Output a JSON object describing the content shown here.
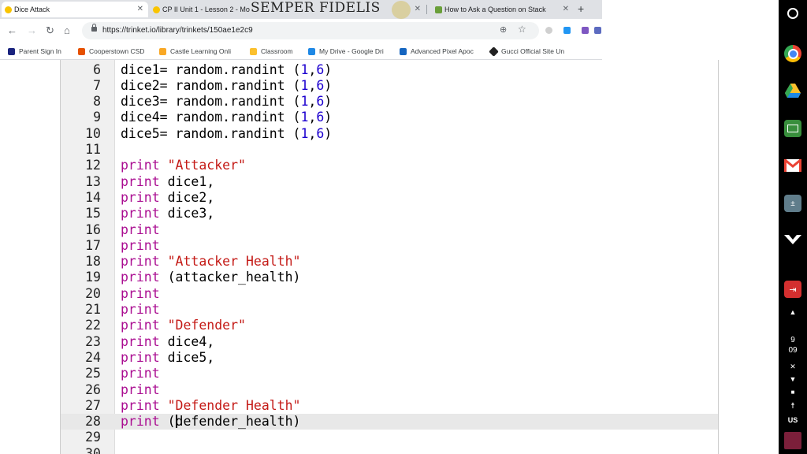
{
  "browser": {
    "tabs": [
      {
        "title": "Dice Attack",
        "active": true
      },
      {
        "title": "CP II Unit 1 - Lesson 2 - Mo",
        "active": false
      },
      {
        "title": "How to Ask a Question on Stack",
        "active": false
      }
    ],
    "new_tab_symbol": "+",
    "url": "https://trinket.io/library/trinkets/150ae1e2c9",
    "bookmarks": [
      {
        "label": "Parent Sign In",
        "icon": "parent-portal-icon",
        "color": "#1a237e"
      },
      {
        "label": "Cooperstown CSD",
        "icon": "cooperstown-icon",
        "color": "#e65100"
      },
      {
        "label": "Castle Learning Onli",
        "icon": "castle-learning-icon",
        "color": "#f9a825"
      },
      {
        "label": "Classroom",
        "icon": "classroom-icon",
        "color": "#fbc02d"
      },
      {
        "label": "My Drive - Google Dri",
        "icon": "drive-icon",
        "color": "#1e88e5"
      },
      {
        "label": "Advanced Pixel Apoc",
        "icon": "pixel-icon",
        "color": "#1565c0"
      },
      {
        "label": "Gucci Official Site Un",
        "icon": "gucci-icon",
        "color": "#212121"
      }
    ]
  },
  "overlay": {
    "text": "SEMPER FIDELIS"
  },
  "editor": {
    "current_line": 28,
    "lines": [
      {
        "n": "6",
        "tokens": [
          {
            "t": "dice1= random.randint (",
            "c": ""
          },
          {
            "t": "1",
            "c": "num"
          },
          {
            "t": ",",
            "c": ""
          },
          {
            "t": "6",
            "c": "num"
          },
          {
            "t": ")",
            "c": ""
          }
        ]
      },
      {
        "n": "7",
        "tokens": [
          {
            "t": "dice2= random.randint (",
            "c": ""
          },
          {
            "t": "1",
            "c": "num"
          },
          {
            "t": ",",
            "c": ""
          },
          {
            "t": "6",
            "c": "num"
          },
          {
            "t": ")",
            "c": ""
          }
        ]
      },
      {
        "n": "8",
        "tokens": [
          {
            "t": "dice3= random.randint (",
            "c": ""
          },
          {
            "t": "1",
            "c": "num"
          },
          {
            "t": ",",
            "c": ""
          },
          {
            "t": "6",
            "c": "num"
          },
          {
            "t": ")",
            "c": ""
          }
        ]
      },
      {
        "n": "9",
        "tokens": [
          {
            "t": "dice4= random.randint (",
            "c": ""
          },
          {
            "t": "1",
            "c": "num"
          },
          {
            "t": ",",
            "c": ""
          },
          {
            "t": "6",
            "c": "num"
          },
          {
            "t": ")",
            "c": ""
          }
        ]
      },
      {
        "n": "10",
        "tokens": [
          {
            "t": "dice5= random.randint (",
            "c": ""
          },
          {
            "t": "1",
            "c": "num"
          },
          {
            "t": ",",
            "c": ""
          },
          {
            "t": "6",
            "c": "num"
          },
          {
            "t": ")",
            "c": ""
          }
        ]
      },
      {
        "n": "11",
        "tokens": []
      },
      {
        "n": "12",
        "tokens": [
          {
            "t": "print",
            "c": "kw"
          },
          {
            "t": " ",
            "c": ""
          },
          {
            "t": "\"Attacker\"",
            "c": "str"
          }
        ]
      },
      {
        "n": "13",
        "tokens": [
          {
            "t": "print",
            "c": "kw"
          },
          {
            "t": " dice1,",
            "c": ""
          }
        ]
      },
      {
        "n": "14",
        "tokens": [
          {
            "t": "print",
            "c": "kw"
          },
          {
            "t": " dice2,",
            "c": ""
          }
        ]
      },
      {
        "n": "15",
        "tokens": [
          {
            "t": "print",
            "c": "kw"
          },
          {
            "t": " dice3,",
            "c": ""
          }
        ]
      },
      {
        "n": "16",
        "tokens": [
          {
            "t": "print",
            "c": "kw"
          }
        ]
      },
      {
        "n": "17",
        "tokens": [
          {
            "t": "print",
            "c": "kw"
          }
        ]
      },
      {
        "n": "18",
        "tokens": [
          {
            "t": "print",
            "c": "kw"
          },
          {
            "t": " ",
            "c": ""
          },
          {
            "t": "\"Attacker Health\"",
            "c": "str"
          }
        ]
      },
      {
        "n": "19",
        "tokens": [
          {
            "t": "print",
            "c": "kw"
          },
          {
            "t": " (attacker_health)",
            "c": ""
          }
        ]
      },
      {
        "n": "20",
        "tokens": [
          {
            "t": "print",
            "c": "kw"
          }
        ]
      },
      {
        "n": "21",
        "tokens": [
          {
            "t": "print",
            "c": "kw"
          }
        ]
      },
      {
        "n": "22",
        "tokens": [
          {
            "t": "print",
            "c": "kw"
          },
          {
            "t": " ",
            "c": ""
          },
          {
            "t": "\"Defender\"",
            "c": "str"
          }
        ]
      },
      {
        "n": "23",
        "tokens": [
          {
            "t": "print",
            "c": "kw"
          },
          {
            "t": " dice4,",
            "c": ""
          }
        ]
      },
      {
        "n": "24",
        "tokens": [
          {
            "t": "print",
            "c": "kw"
          },
          {
            "t": " dice5,",
            "c": ""
          }
        ]
      },
      {
        "n": "25",
        "tokens": [
          {
            "t": "print",
            "c": "kw"
          }
        ]
      },
      {
        "n": "26",
        "tokens": [
          {
            "t": "print",
            "c": "kw"
          }
        ]
      },
      {
        "n": "27",
        "tokens": [
          {
            "t": "print",
            "c": "kw"
          },
          {
            "t": " ",
            "c": ""
          },
          {
            "t": "\"Defender Health\"",
            "c": "str"
          }
        ]
      },
      {
        "n": "28",
        "tokens": [
          {
            "t": "print",
            "c": "kw"
          },
          {
            "t": " (",
            "c": ""
          },
          {
            "t": "|",
            "c": "cursor"
          },
          {
            "t": "defender_health)",
            "c": ""
          }
        ]
      },
      {
        "n": "29",
        "tokens": []
      },
      {
        "n": "30",
        "tokens": []
      }
    ]
  },
  "shelf": {
    "apps": [
      {
        "icon": "chrome-icon",
        "color": "#4caf50"
      },
      {
        "icon": "google-drive-icon",
        "color": "#fbc02d"
      },
      {
        "icon": "google-classroom-icon",
        "color": "#388e3c"
      },
      {
        "icon": "gmail-icon",
        "color": "#ea4335"
      },
      {
        "icon": "calculator-icon",
        "color": "#607d8b"
      },
      {
        "icon": "air-force-icon",
        "color": "#ffffff"
      },
      {
        "icon": "sign-out-icon",
        "color": "#d32f2f"
      }
    ],
    "clock_hour": "9",
    "clock_minute": "09",
    "locale": "US"
  },
  "colors": {
    "keyword": "#aa0d91",
    "string": "#c41a16",
    "number": "#1c00cf"
  }
}
